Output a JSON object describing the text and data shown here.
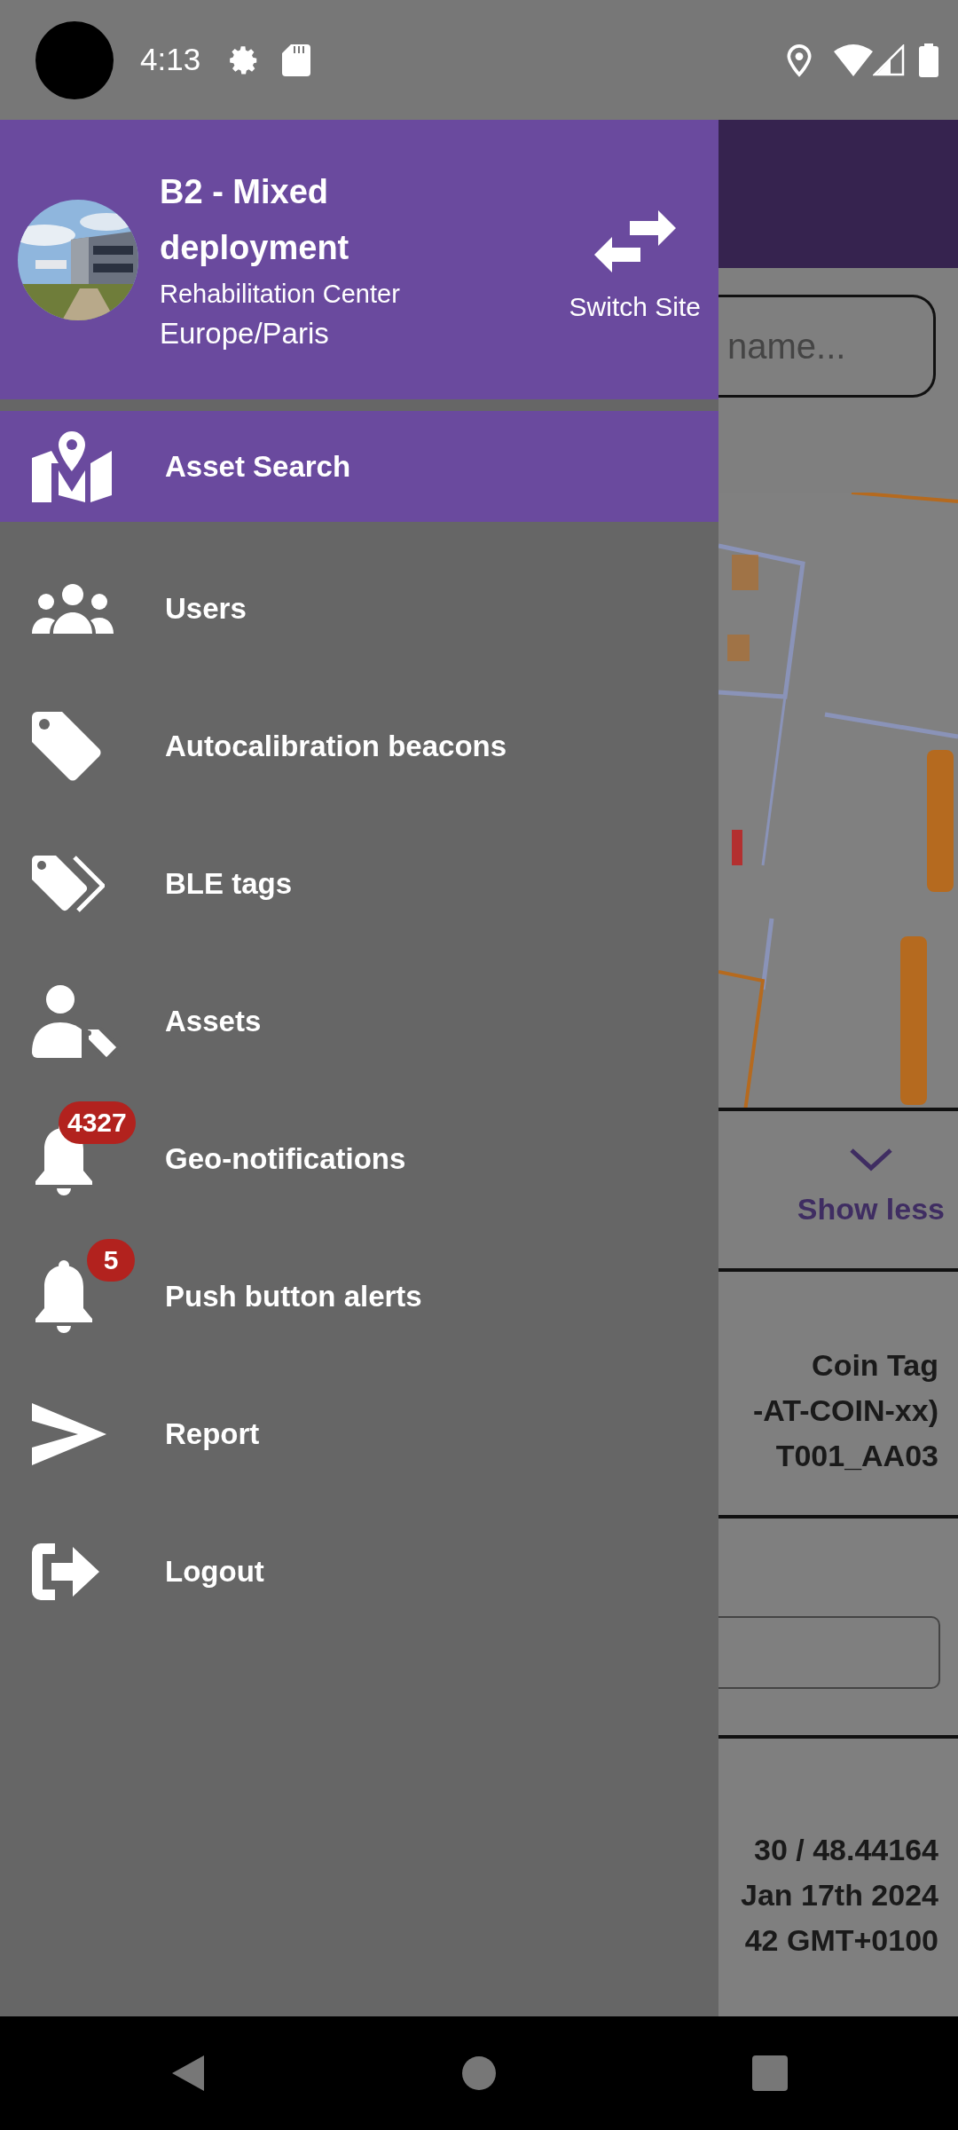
{
  "status_bar": {
    "time": "4:13"
  },
  "drawer": {
    "site": {
      "name": "B2 - Mixed deployment",
      "category": "Rehabilitation Center",
      "timezone": "Europe/Paris"
    },
    "switch_label": "Switch Site",
    "items": [
      {
        "label": "Asset Search",
        "selected": true
      },
      {
        "label": "Users",
        "selected": false
      },
      {
        "label": "Autocalibration beacons",
        "selected": false
      },
      {
        "label": "BLE tags",
        "selected": false
      },
      {
        "label": "Assets",
        "selected": false
      },
      {
        "label": "Geo-notifications",
        "selected": false,
        "badge": "4327"
      },
      {
        "label": "Push button alerts",
        "selected": false,
        "badge": "5"
      },
      {
        "label": "Report",
        "selected": false
      },
      {
        "label": "Logout",
        "selected": false
      }
    ]
  },
  "background": {
    "search": {
      "placeholder": "name..."
    },
    "show_less": "Show less",
    "tag_lines": [
      "Coin Tag",
      "-AT-COIN-xx)",
      "T001_AA03"
    ],
    "location_lines": [
      "30 / 48.44164",
      "Jan 17th 2024",
      "42 GMT+0100"
    ]
  }
}
